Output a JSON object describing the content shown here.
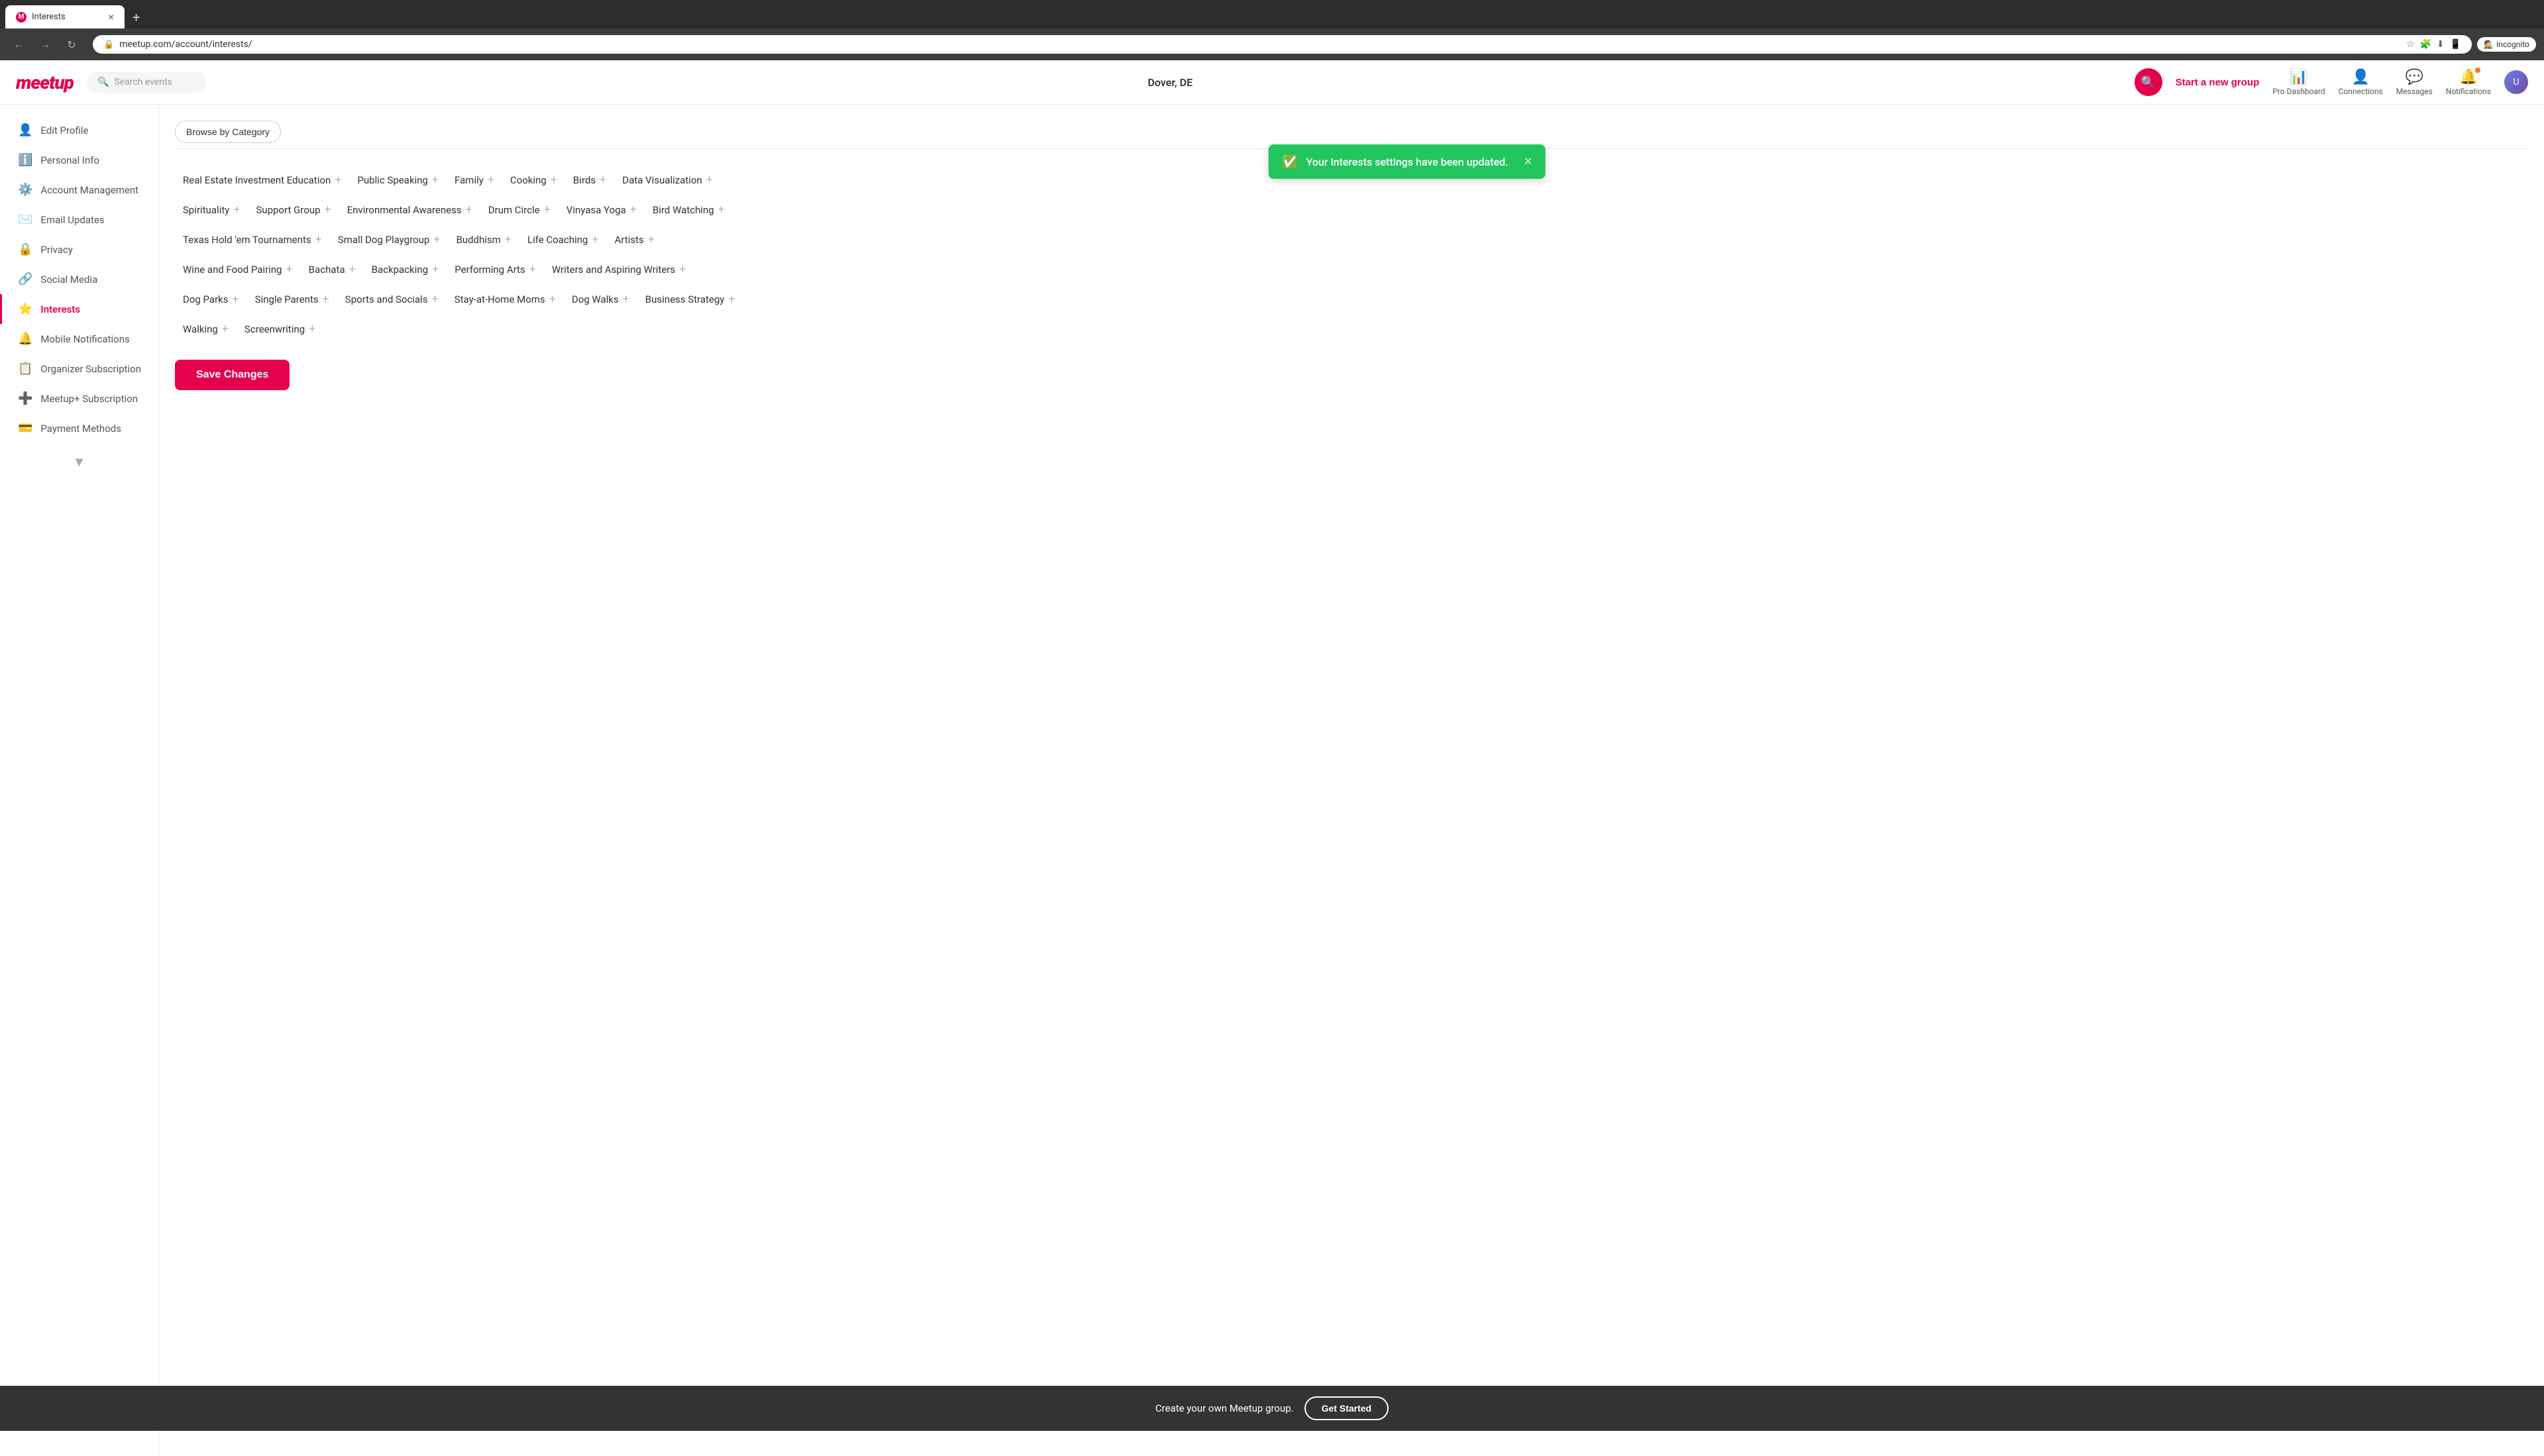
{
  "browser": {
    "tab_title": "Interests",
    "address": "meetup.com/account/interests/",
    "new_tab_icon": "+",
    "close_icon": "×",
    "nav_back": "←",
    "nav_forward": "→",
    "nav_refresh": "↻",
    "incognito_label": "Incognito",
    "minimize_label": "–",
    "maximize_label": "⬜",
    "close_label": "✕"
  },
  "header": {
    "logo": "meetup",
    "search_placeholder": "Search events",
    "location": "Dover, DE",
    "search_button_icon": "🔍",
    "start_group": "Start a new group",
    "nav": [
      {
        "id": "pro-dashboard",
        "label": "Pro Dashboard",
        "icon": "📊"
      },
      {
        "id": "connections",
        "label": "Connections",
        "icon": "👤"
      },
      {
        "id": "messages",
        "label": "Messages",
        "icon": "💬"
      },
      {
        "id": "notifications",
        "label": "Notifications",
        "icon": "🔔"
      }
    ]
  },
  "sidebar": {
    "items": [
      {
        "id": "edit-profile",
        "icon": "👤",
        "label": "Edit Profile",
        "active": false
      },
      {
        "id": "personal-info",
        "icon": "ℹ️",
        "label": "Personal Info",
        "active": false
      },
      {
        "id": "account-management",
        "icon": "⚙️",
        "label": "Account Management",
        "active": false
      },
      {
        "id": "email-updates",
        "icon": "✉️",
        "label": "Email Updates",
        "active": false
      },
      {
        "id": "privacy",
        "icon": "🔒",
        "label": "Privacy",
        "active": false
      },
      {
        "id": "social-media",
        "icon": "🔗",
        "label": "Social Media",
        "active": false
      },
      {
        "id": "interests",
        "icon": "⭐",
        "label": "Interests",
        "active": true
      },
      {
        "id": "mobile-notifications",
        "icon": "🔔",
        "label": "Mobile Notifications",
        "active": false
      },
      {
        "id": "organizer-subscription",
        "icon": "📋",
        "label": "Organizer Subscription",
        "active": false
      },
      {
        "id": "meetup-plus",
        "icon": "➕",
        "label": "Meetup+ Subscription",
        "active": false
      },
      {
        "id": "payment-methods",
        "icon": "💳",
        "label": "Payment Methods",
        "active": false
      }
    ]
  },
  "category_bar": {
    "browse_label": "Browse by Category"
  },
  "notification": {
    "message": "Your interests settings have been updated.",
    "close_icon": "×"
  },
  "interests": {
    "rows": [
      [
        {
          "label": "Real Estate Investment Education"
        },
        {
          "label": "Public Speaking"
        },
        {
          "label": "Family"
        },
        {
          "label": "Cooking"
        },
        {
          "label": "Birds"
        },
        {
          "label": "Data Visualization"
        }
      ],
      [
        {
          "label": "Spirituality"
        },
        {
          "label": "Support Group"
        },
        {
          "label": "Environmental Awareness"
        },
        {
          "label": "Drum Circle"
        },
        {
          "label": "Vinyasa Yoga"
        },
        {
          "label": "Bird Watching"
        }
      ],
      [
        {
          "label": "Texas Hold 'em Tournaments"
        },
        {
          "label": "Small Dog Playgroup"
        },
        {
          "label": "Buddhism"
        },
        {
          "label": "Life Coaching"
        },
        {
          "label": "Artists"
        }
      ],
      [
        {
          "label": "Wine and Food Pairing"
        },
        {
          "label": "Bachata"
        },
        {
          "label": "Backpacking"
        },
        {
          "label": "Performing Arts"
        },
        {
          "label": "Writers and Aspiring Writers"
        }
      ],
      [
        {
          "label": "Dog Parks"
        },
        {
          "label": "Single Parents"
        },
        {
          "label": "Sports and Socials"
        },
        {
          "label": "Stay-at-Home Moms"
        },
        {
          "label": "Dog Walks"
        },
        {
          "label": "Business Strategy"
        }
      ],
      [
        {
          "label": "Walking"
        },
        {
          "label": "Screenwriting"
        }
      ]
    ]
  },
  "save_button": "Save Changes",
  "bottom_banner": {
    "text": "Create your own Meetup group.",
    "button": "Get Started"
  }
}
